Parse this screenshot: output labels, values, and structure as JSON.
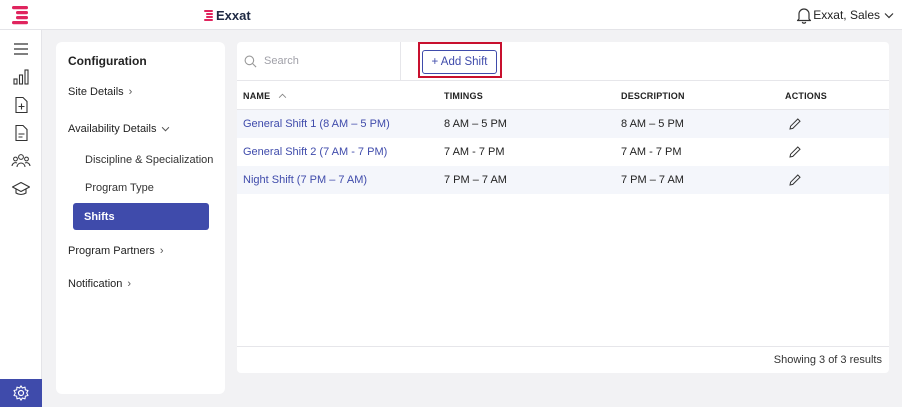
{
  "header": {
    "brand": "Exxat",
    "user": "Exxat, Sales",
    "brand_color": "#e0245e"
  },
  "rail": {
    "icons": [
      "menu-icon",
      "bar-chart-icon",
      "add-file-icon",
      "document-icon",
      "users-icon",
      "graduation-cap-icon",
      "gear-icon"
    ],
    "accent": "#3f4bab"
  },
  "config": {
    "title": "Configuration",
    "items": {
      "site_details": "Site Details",
      "availability_details": "Availability Details",
      "discipline": "Discipline & Specialization",
      "program_type": "Program Type",
      "shifts": "Shifts",
      "program_partners": "Program Partners",
      "notification": "Notification"
    }
  },
  "toolbar": {
    "search_placeholder": "Search",
    "add_label": "+ Add Shift"
  },
  "table": {
    "columns": [
      "NAME",
      "TIMINGS",
      "DESCRIPTION",
      "ACTIONS"
    ],
    "rows": [
      {
        "name": "General Shift 1 (8 AM – 5 PM)",
        "timings": "8 AM – 5 PM",
        "description": "8 AM – 5 PM"
      },
      {
        "name": "General Shift 2 (7 AM - 7 PM)",
        "timings": "7 AM - 7 PM",
        "description": "7 AM - 7 PM"
      },
      {
        "name": "Night Shift (7 PM – 7 AM)",
        "timings": "7 PM – 7 AM",
        "description": "7 PM – 7 AM"
      }
    ],
    "footer": "Showing 3 of 3 results"
  }
}
